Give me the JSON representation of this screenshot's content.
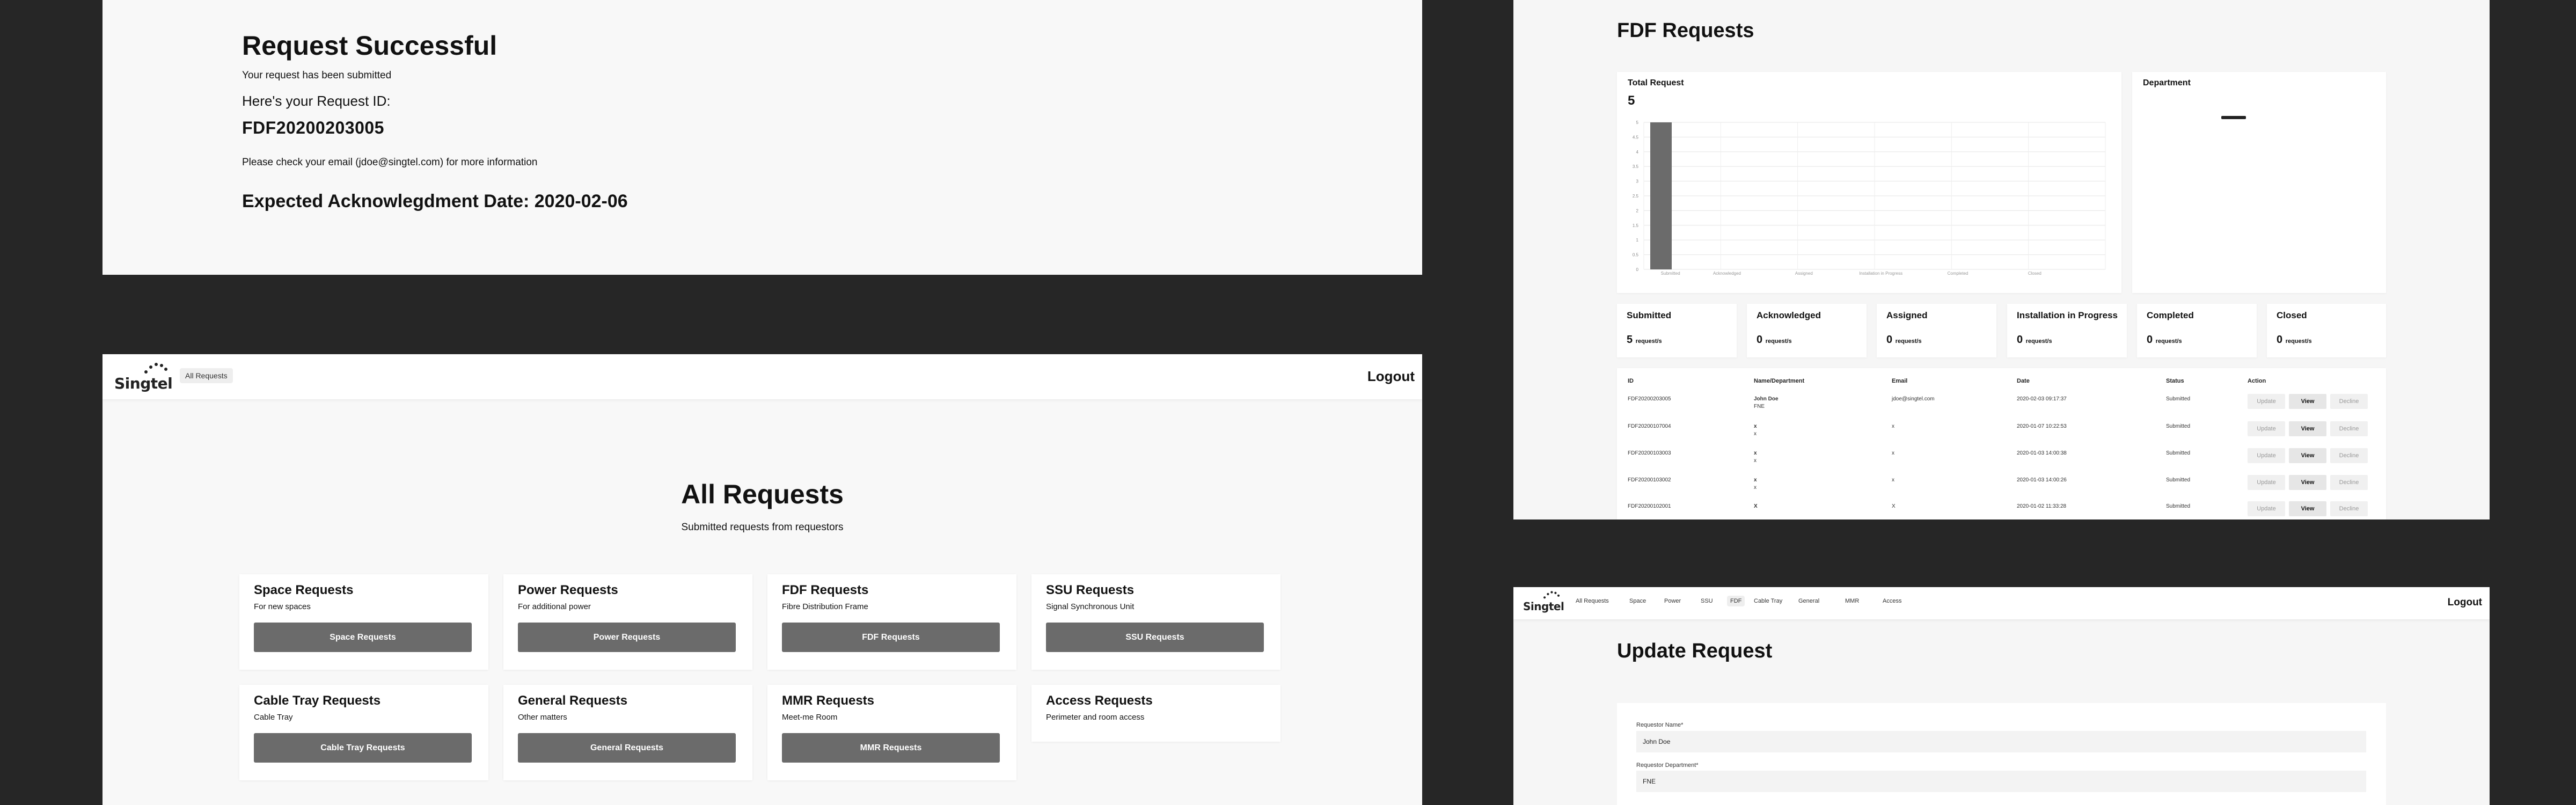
{
  "success": {
    "title": "Request Successful",
    "submitted": "Your request has been submitted",
    "id_label": "Here's your Request ID:",
    "request_id": "FDF20200203005",
    "email_note": "Please check your email (jdoe@singtel.com) for more information",
    "expected": "Expected Acknowlegdment Date: 2020-02-06"
  },
  "brand": {
    "logo_text": "Singtel"
  },
  "all": {
    "nav_all": "All Requests",
    "logout": "Logout",
    "title": "All Requests",
    "subtitle": "Submitted requests from requestors",
    "cards": [
      {
        "title": "Space Requests",
        "desc": "For new spaces",
        "button": "Space Requests"
      },
      {
        "title": "Power Requests",
        "desc": "For additional power",
        "button": "Power Requests"
      },
      {
        "title": "FDF Requests",
        "desc": "Fibre Distribution Frame",
        "button": "FDF Requests"
      },
      {
        "title": "SSU Requests",
        "desc": "Signal Synchronous Unit",
        "button": "SSU Requests"
      },
      {
        "title": "Cable Tray Requests",
        "desc": "Cable Tray",
        "button": "Cable Tray Requests"
      },
      {
        "title": "General Requests",
        "desc": "Other matters",
        "button": "General Requests"
      },
      {
        "title": "MMR Requests",
        "desc": "Meet-me Room",
        "button": "MMR Requests"
      },
      {
        "title": "Access Requests",
        "desc": "Perimeter and room access",
        "button": ""
      }
    ]
  },
  "fdf": {
    "title": "FDF Requests",
    "total_label": "Total Request",
    "total": "5",
    "department_label": "Department",
    "stats": [
      {
        "label": "Submitted",
        "value": "5",
        "unit": "request/s"
      },
      {
        "label": "Acknowledged",
        "value": "0",
        "unit": "request/s"
      },
      {
        "label": "Assigned",
        "value": "0",
        "unit": "request/s"
      },
      {
        "label": "Installation in Progress",
        "value": "0",
        "unit": "request/s"
      },
      {
        "label": "Completed",
        "value": "0",
        "unit": "request/s"
      },
      {
        "label": "Closed",
        "value": "0",
        "unit": "request/s"
      }
    ],
    "columns": [
      "ID",
      "Name/Department",
      "Email",
      "Date",
      "Status",
      "Action"
    ],
    "rows": [
      {
        "id": "FDF20200203005",
        "name": "John Doe",
        "dept": "FNE",
        "email": "jdoe@singtel.com",
        "date": "2020-02-03 09:17:37",
        "status": "Submitted"
      },
      {
        "id": "FDF20200107004",
        "name": "x",
        "dept": "x",
        "email": "x",
        "date": "2020-01-07 10:22:53",
        "status": "Submitted"
      },
      {
        "id": "FDF20200103003",
        "name": "x",
        "dept": "x",
        "email": "x",
        "date": "2020-01-03 14:00:38",
        "status": "Submitted"
      },
      {
        "id": "FDF20200103002",
        "name": "x",
        "dept": "x",
        "email": "x",
        "date": "2020-01-03 14:00:26",
        "status": "Submitted"
      },
      {
        "id": "FDF20200102001",
        "name": "X",
        "dept": "",
        "email": "X",
        "date": "2020-01-02 11:33:28",
        "status": "Submitted"
      }
    ],
    "actions": {
      "update": "Update",
      "view": "View",
      "decline": "Decline"
    }
  },
  "chart_data": {
    "type": "bar",
    "categories": [
      "Submitted",
      "Acknowledged",
      "Assigned",
      "Installation in Progress",
      "Completed",
      "Closed"
    ],
    "values": [
      5,
      0,
      0,
      0,
      0,
      0
    ],
    "ylim": [
      0,
      5
    ],
    "yticks": [
      "0",
      "0.5",
      "1",
      "1.5",
      "2",
      "2.5",
      "3",
      "3.5",
      "4",
      "4.5",
      "5"
    ],
    "grid": true,
    "bar_color": "#6b6b6b"
  },
  "update": {
    "nav": [
      "All Requests",
      "Space",
      "Power",
      "SSU",
      "FDF",
      "Cable Tray",
      "General",
      "MMR",
      "Access"
    ],
    "logout": "Logout",
    "title": "Update Request",
    "name_label": "Requestor Name*",
    "name_value": "John Doe",
    "dept_label": "Requestor Department*",
    "dept_value": "FNE"
  }
}
